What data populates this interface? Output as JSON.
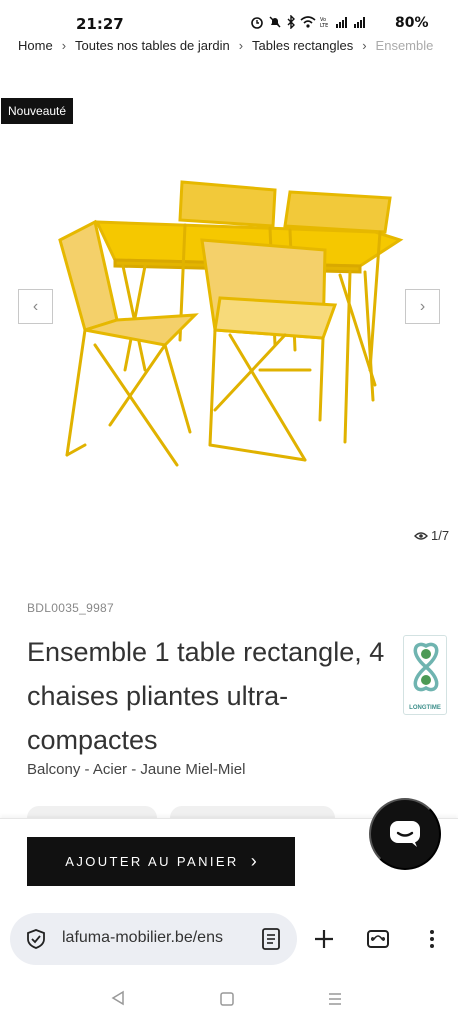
{
  "status": {
    "time": "21:27",
    "icons": [
      "alarm-icon",
      "mute-icon",
      "bluetooth-icon",
      "wifi-icon",
      "volte-icon",
      "signal-icon"
    ],
    "battery": "80%"
  },
  "breadcrumb": {
    "items": [
      "Home",
      "Toutes nos tables de jardin",
      "Tables rectangles",
      "Ensemble"
    ]
  },
  "badge": "Nouveauté",
  "gallery": {
    "counter": "1/7",
    "product_color": "#f2c400"
  },
  "product": {
    "sku": "BDL0035_9987",
    "title": "Ensemble 1 table rectangle, 4 chaises pliantes ultra-compactes",
    "subtitle": "Balcony  - Acier  - Jaune Miel-Miel",
    "label": "LONGTIME"
  },
  "cart": {
    "button_label": "AJOUTER AU PANIER"
  },
  "browser": {
    "url": "lafuma-mobilier.be/ens"
  }
}
